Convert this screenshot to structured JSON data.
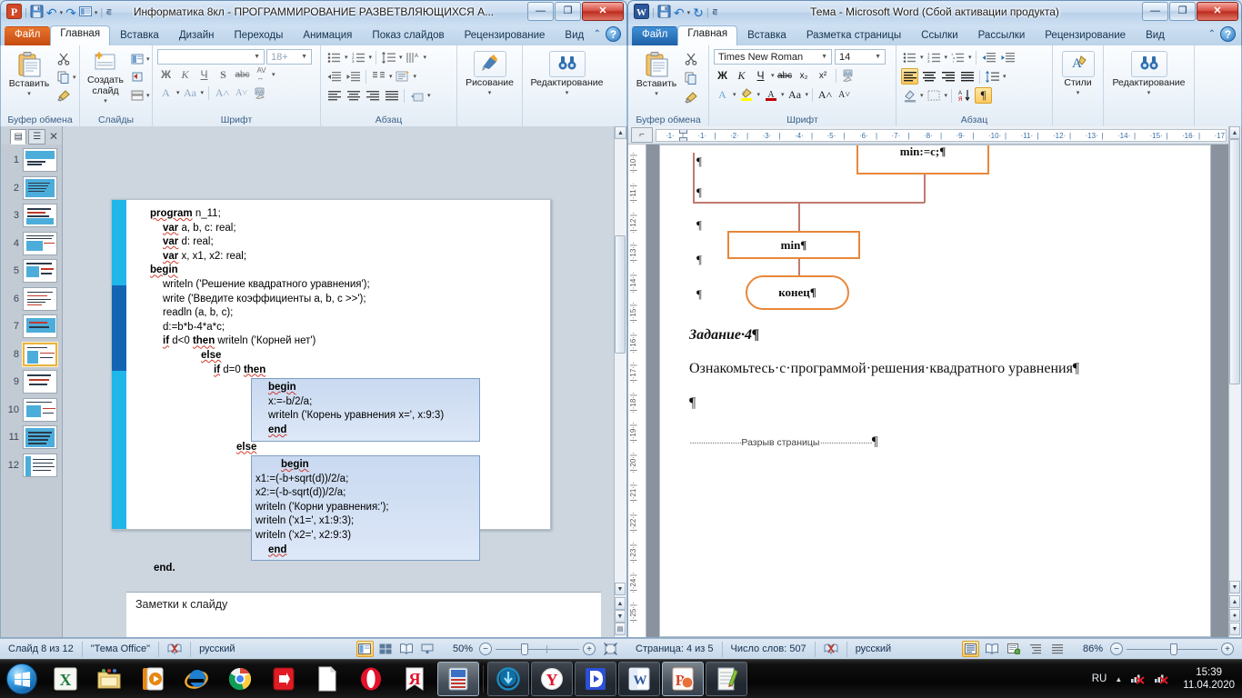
{
  "powerpoint": {
    "title": "Информатика 8кл - ПРОГРАММИРОВАНИЕ РАЗВЕТВЛЯЮЩИХСЯ А...",
    "qat": [
      "save-icon",
      "undo-icon",
      "redo-icon",
      "presentation-icon",
      "customize-icon"
    ],
    "window_buttons": {
      "minimize": "—",
      "maximize": "❐",
      "close": "✕"
    },
    "tabs": [
      {
        "label": "Файл",
        "active": false,
        "kind": "file"
      },
      {
        "label": "Главная",
        "active": true
      },
      {
        "label": "Вставка",
        "active": false
      },
      {
        "label": "Дизайн",
        "active": false
      },
      {
        "label": "Переходы",
        "active": false
      },
      {
        "label": "Анимация",
        "active": false
      },
      {
        "label": "Показ слайдов",
        "active": false
      },
      {
        "label": "Рецензирование",
        "active": false
      },
      {
        "label": "Вид",
        "active": false
      }
    ],
    "groups": {
      "clipboard": {
        "label": "Буфер обмена",
        "paste": "Вставить"
      },
      "slides": {
        "label": "Слайды",
        "new_slide": "Создать\nслайд"
      },
      "font": {
        "label": "Шрифт",
        "font_name": "",
        "font_size": "18+",
        "buttons": [
          "Ж",
          "К",
          "Ч",
          "S",
          "abc",
          "AV"
        ]
      },
      "paragraph": {
        "label": "Абзац"
      },
      "drawing": {
        "label": "Рисование"
      },
      "editing": {
        "label": "Редактирование"
      }
    },
    "slide_panel": {
      "tabs": [
        "slides-tab",
        "outline-tab"
      ],
      "close": "✕",
      "slides": [
        "1",
        "2",
        "3",
        "4",
        "5",
        "6",
        "7",
        "8",
        "9",
        "10",
        "11",
        "12"
      ],
      "selected": 8
    },
    "slide_code": [
      {
        "indent": 0,
        "parts": [
          {
            "t": "program",
            "b": true
          },
          {
            "t": " n_11;"
          }
        ]
      },
      {
        "indent": 1,
        "parts": [
          {
            "t": "var",
            "b": true
          },
          {
            "t": " a, b, c: real;"
          }
        ]
      },
      {
        "indent": 1,
        "parts": [
          {
            "t": "var",
            "b": true
          },
          {
            "t": " d: real;"
          }
        ]
      },
      {
        "indent": 1,
        "parts": [
          {
            "t": "var",
            "b": true
          },
          {
            "t": " x, x1, x2: real;"
          }
        ]
      },
      {
        "indent": 0,
        "parts": [
          {
            "t": "begin",
            "b": true
          }
        ]
      },
      {
        "indent": 1,
        "parts": [
          {
            "t": "writeln ('Решение квадратного уравнения');"
          }
        ]
      },
      {
        "indent": 1,
        "parts": [
          {
            "t": "write ('Введите коэффициенты a, b, c  >>');"
          }
        ]
      },
      {
        "indent": 1,
        "parts": [
          {
            "t": "readln (a, b, c);"
          }
        ]
      },
      {
        "indent": 1,
        "parts": [
          {
            "t": "d:=b*b-4*a*c;"
          }
        ]
      },
      {
        "indent": 1,
        "parts": [
          {
            "t": "if",
            "b": true
          },
          {
            "t": " d<0 "
          },
          {
            "t": "then",
            "b": true
          },
          {
            "t": " writeln ('Корней нет')"
          }
        ]
      },
      {
        "indent": 4,
        "parts": [
          {
            "t": "else",
            "b": true
          }
        ]
      },
      {
        "indent": 5,
        "parts": [
          {
            "t": "if",
            "b": true
          },
          {
            "t": " d=0 "
          },
          {
            "t": "then",
            "b": true
          }
        ]
      }
    ],
    "code_block_1": [
      {
        "indent": 1,
        "parts": [
          {
            "t": "begin",
            "b": true
          }
        ]
      },
      {
        "indent": 1,
        "parts": [
          {
            "t": "x:=-b/2/a;"
          }
        ]
      },
      {
        "indent": 1,
        "parts": [
          {
            "t": "writeln ('Корень уравнения x=', x:9:3)"
          }
        ]
      },
      {
        "indent": 1,
        "parts": [
          {
            "t": "end",
            "b": true
          }
        ]
      }
    ],
    "code_else": "else",
    "code_block_2": [
      {
        "indent": 2,
        "parts": [
          {
            "t": "begin",
            "b": true
          }
        ]
      },
      {
        "indent": 0,
        "parts": [
          {
            "t": "x1:=(-b+sqrt(d))/2/a;"
          }
        ]
      },
      {
        "indent": 0,
        "parts": [
          {
            "t": "x2:=(-b-sqrt(d))/2/a;"
          }
        ]
      },
      {
        "indent": 0,
        "parts": [
          {
            "t": "writeln ('Корни уравнения:');"
          }
        ]
      },
      {
        "indent": 0,
        "parts": [
          {
            "t": "writeln ('x1=', x1:9:3);"
          }
        ]
      },
      {
        "indent": 0,
        "parts": [
          {
            "t": "writeln ('x2=', x2:9:3)"
          }
        ]
      },
      {
        "indent": 1,
        "parts": [
          {
            "t": "end",
            "b": true
          }
        ]
      }
    ],
    "code_end": "end.",
    "notes_placeholder": "Заметки к слайду",
    "status": {
      "slide_counter": "Слайд 8 из 12",
      "theme": "\"Тема Office\"",
      "language": "русский",
      "zoom": "50%",
      "views": [
        "normal-view",
        "slide-sorter-view",
        "reading-view",
        "slideshow-view"
      ]
    },
    "accent_color": "#1fb6ea",
    "accent_color_dark": "#1464b4"
  },
  "word": {
    "title": "Тема - Microsoft Word (Сбой активации продукта)",
    "qat": [
      "save-icon",
      "undo-icon",
      "redo-icon",
      "customize-icon"
    ],
    "window_buttons": {
      "minimize": "—",
      "maximize": "❐",
      "close": "✕"
    },
    "tabs": [
      {
        "label": "Файл",
        "active": false,
        "kind": "file"
      },
      {
        "label": "Главная",
        "active": true
      },
      {
        "label": "Вставка",
        "active": false
      },
      {
        "label": "Разметка страницы",
        "active": false
      },
      {
        "label": "Ссылки",
        "active": false
      },
      {
        "label": "Рассылки",
        "active": false
      },
      {
        "label": "Рецензирование",
        "active": false
      },
      {
        "label": "Вид",
        "active": false
      }
    ],
    "groups": {
      "clipboard": {
        "label": "Буфер обмена",
        "paste": "Вставить"
      },
      "font": {
        "label": "Шрифт",
        "font_name": "Times New Roman",
        "font_size": "14",
        "buttons": [
          "Ж",
          "К",
          "Ч",
          "abc",
          "x₂",
          "x²"
        ]
      },
      "paragraph": {
        "label": "Абзац"
      },
      "styles": {
        "label": "Стили"
      },
      "editing": {
        "label": "Редактирование"
      }
    },
    "ruler": {
      "h_marks": [
        "1",
        "1",
        "2",
        "3",
        "4",
        "5",
        "6",
        "7",
        "8",
        "9",
        "10",
        "11",
        "12",
        "13",
        "14",
        "15",
        "16",
        "17"
      ],
      "v_marks": [
        "10",
        "11",
        "12",
        "13",
        "14",
        "15",
        "16",
        "17",
        "18",
        "19",
        "20",
        "21",
        "22",
        "23",
        "24",
        "25"
      ]
    },
    "document": {
      "flow_box_1": "min:=c;¶",
      "flow_box_2": "min¶",
      "flow_box_3": "конец¶",
      "heading": "Задание·4¶",
      "body": "Ознакомьтесь·с·программой·решения·квадратного уравнения¶",
      "empty_para": "¶",
      "page_break": "Разрыв страницы",
      "pilcrow": "¶"
    },
    "status": {
      "page_counter": "Страница: 4 из 5",
      "word_count": "Число слов: 507",
      "language": "русский",
      "zoom": "86%"
    },
    "accent_color": "#e8873a"
  },
  "taskbar": {
    "start": "start-orb",
    "items": [
      {
        "name": "excel-icon",
        "open": false
      },
      {
        "name": "folder-icon",
        "open": false
      },
      {
        "name": "media-player-icon",
        "open": false
      },
      {
        "name": "internet-explorer-icon",
        "open": false
      },
      {
        "name": "chrome-icon",
        "open": false
      },
      {
        "name": "red-app-icon",
        "open": false
      },
      {
        "name": "document-icon",
        "open": false
      },
      {
        "name": "opera-icon",
        "open": false
      },
      {
        "name": "yandex-icon",
        "open": false
      },
      {
        "name": "notepad-editor-icon",
        "open": true
      }
    ],
    "running": [
      {
        "name": "download-manager-icon",
        "open": true
      },
      {
        "name": "yandex-browser-icon",
        "open": true
      },
      {
        "name": "media-player-d-icon",
        "open": true
      },
      {
        "name": "word-icon",
        "open": true
      },
      {
        "name": "powerpoint-icon",
        "active": true
      },
      {
        "name": "notepad-icon",
        "open": true
      }
    ],
    "tray": {
      "language": "RU",
      "show_hidden": "▲",
      "icons": [
        "network-disconnected-icon",
        "network-error-icon"
      ],
      "time": "15:39",
      "date": "11.04.2020"
    }
  }
}
